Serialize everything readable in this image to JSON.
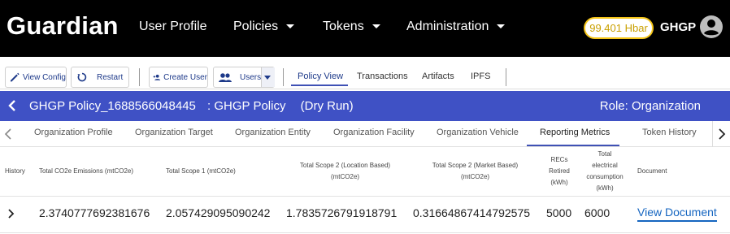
{
  "app": {
    "logo": "Guardian",
    "nav": [
      {
        "label": "User Profile"
      },
      {
        "label": "Policies"
      },
      {
        "label": "Tokens"
      },
      {
        "label": "Administration"
      }
    ],
    "balance": "99.401 Hbar",
    "username": "GHGP"
  },
  "toolbar": {
    "view_config": "View Config",
    "restart": "Restart",
    "create_user": "Create User",
    "users": "Users",
    "tabs": [
      "Policy View",
      "Transactions",
      "Artifacts",
      "IPFS"
    ],
    "active_tab": "Policy View"
  },
  "policy": {
    "title": "GHGP Policy_1688566048445",
    "subtitle": ": GHGP Policy",
    "mode": "(Dry Run)",
    "role": "Role: Organization"
  },
  "subtabs": {
    "items": [
      "Organization Profile",
      "Organization Target",
      "Organization Entity",
      "Organization Facility",
      "Organization Vehicle",
      "Reporting Metrics",
      "Token History"
    ],
    "active": "Reporting Metrics"
  },
  "table": {
    "headers": {
      "history": "History",
      "total_co2e": "Total CO2e Emissions (mtCO2e)",
      "scope1": "Total Scope 1 (mtCO2e)",
      "scope2_loc_1": "Total Scope 2 (Location Based)",
      "scope2_loc_2": "(mtCO2e)",
      "scope2_mkt_1": "Total Scope 2 (Market Based)",
      "scope2_mkt_2": "(mtCO2e)",
      "recs_1": "RECs",
      "recs_2": "Retired",
      "recs_3": "(kWh)",
      "elec_1": "Total",
      "elec_2": "electrical",
      "elec_3": "consumption",
      "elec_4": "(kWh)",
      "document": "Document"
    },
    "rows": [
      {
        "total_co2e": "2.3740777692381676",
        "scope1": "2.057429095090242",
        "scope2_loc": "1.7835726791918791",
        "scope2_mkt": "0.31664867414792575",
        "recs": "5000",
        "elec": "6000",
        "document": "View Document"
      }
    ]
  },
  "colors": {
    "nav_bg": "#000000",
    "policy_bar": "#3f51c5",
    "accent": "#3f51b5",
    "balance_border": "#f5c518",
    "link": "#1565c0"
  }
}
